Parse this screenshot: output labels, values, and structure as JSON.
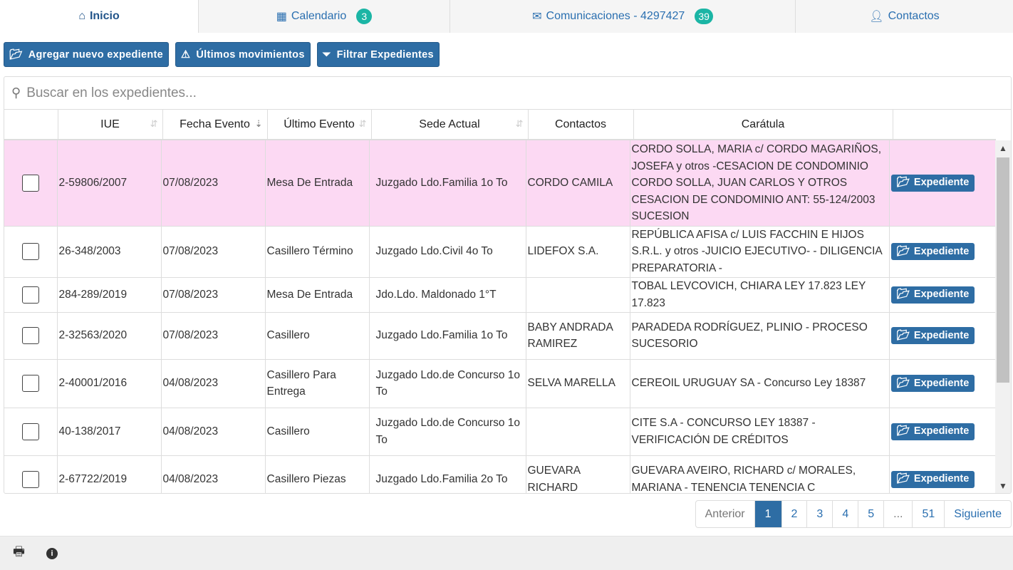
{
  "tabs": [
    {
      "label": "Inicio",
      "icon": "home-icon"
    },
    {
      "label": "Calendario",
      "icon": "calendar-icon",
      "badge": "3"
    },
    {
      "label": "Comunicaciones - 4297427",
      "icon": "envelope-icon",
      "badge": "39"
    },
    {
      "label": "Contactos",
      "icon": "user-icon"
    }
  ],
  "toolbar": {
    "add": "Agregar nuevo expediente",
    "latest": "Últimos movimientos",
    "filter": "Filtrar Expedientes"
  },
  "search": {
    "placeholder": "Buscar en los expedientes..."
  },
  "columns": [
    "IUE",
    "Fecha Evento",
    "Último Evento",
    "Sede Actual",
    "Contactos",
    "Carátula"
  ],
  "rows": [
    {
      "iue": "2-59806/2007",
      "fecha": "07/08/2023",
      "evento": "Mesa De Entrada",
      "sede": "Juzgado Ldo.Familia 1o To",
      "contacto": "CORDO CAMILA",
      "caratula": "CORDO SOLLA, MARIA c/ CORDO MAGARIÑOS, JOSEFA y otros -CESACION DE CONDOMINIO CORDO SOLLA, JUAN CARLOS Y OTROS CESACION DE CONDOMINIO ANT: 55-124/2003 SUCESION",
      "selected": true
    },
    {
      "iue": "26-348/2003",
      "fecha": "07/08/2023",
      "evento": "Casillero Término",
      "sede": "Juzgado Ldo.Civil 4o To",
      "contacto": "LIDEFOX S.A.",
      "caratula": "REPÚBLICA AFISA c/ LUIS FACCHIN E HIJOS S.R.L. y otros -JUICIO EJECUTIVO- - DILIGENCIA PREPARATORIA -"
    },
    {
      "iue": "284-289/2019",
      "fecha": "07/08/2023",
      "evento": "Mesa De Entrada",
      "sede": "Jdo.Ldo. Maldonado 1°T",
      "contacto": "",
      "caratula": "TOBAL LEVCOVICH, CHIARA LEY 17.823 LEY 17.823"
    },
    {
      "iue": "2-32563/2020",
      "fecha": "07/08/2023",
      "evento": "Casillero",
      "sede": "Juzgado Ldo.Familia 1o To",
      "contacto": "BABY ANDRADA RAMIREZ",
      "caratula": "PARADEDA RODRÍGUEZ, PLINIO - PROCESO SUCESORIO"
    },
    {
      "iue": "2-40001/2016",
      "fecha": "04/08/2023",
      "evento": "Casillero Para Entrega",
      "sede": "Juzgado Ldo.de Concurso 1o To",
      "contacto": "SELVA MARELLA",
      "caratula": "CEREOIL URUGUAY SA - Concurso Ley 18387"
    },
    {
      "iue": "40-138/2017",
      "fecha": "04/08/2023",
      "evento": "Casillero",
      "sede": "Juzgado Ldo.de Concurso 1o To",
      "contacto": "",
      "caratula": "CITE S.A - CONCURSO LEY 18387 - VERIFICACIÓN DE CRÉDITOS"
    },
    {
      "iue": "2-67722/2019",
      "fecha": "04/08/2023",
      "evento": "Casillero Piezas",
      "sede": "Juzgado Ldo.Familia 2o To",
      "contacto": "GUEVARA RICHARD",
      "caratula": "GUEVARA AVEIRO, RICHARD c/ MORALES, MARIANA - TENENCIA TENENCIA C"
    }
  ],
  "row_action": "Expediente",
  "pagination": {
    "prev": "Anterior",
    "pages": [
      "1",
      "2",
      "3",
      "4",
      "5",
      "...",
      "51"
    ],
    "current": "1",
    "next": "Siguiente"
  },
  "colors": {
    "primary": "#2e6da4",
    "badge": "#1bb5a5",
    "selected_row": "#fcd9f3"
  }
}
